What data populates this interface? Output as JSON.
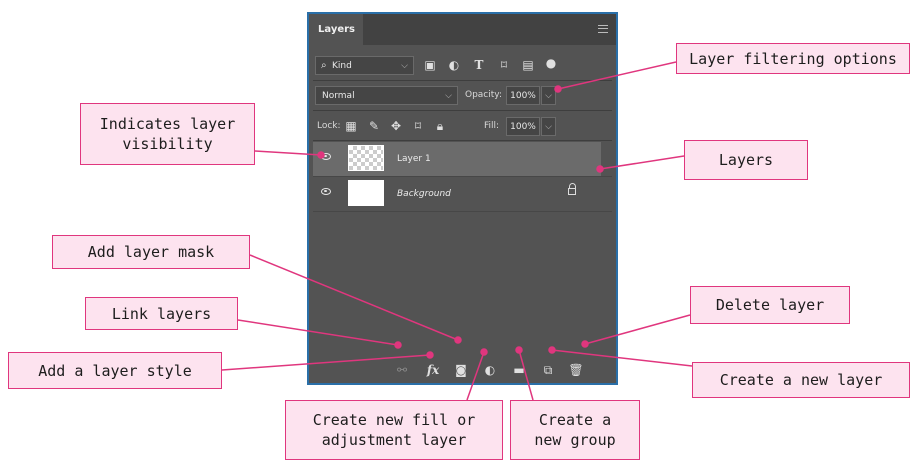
{
  "panel": {
    "tab_label": "Layers",
    "filter": {
      "kind_label": "Kind"
    },
    "blend": {
      "mode": "Normal",
      "opacity_label": "Opacity:",
      "opacity_value": "100%"
    },
    "lock": {
      "lock_label": "Lock:",
      "fill_label": "Fill:",
      "fill_value": "100%"
    },
    "layers": [
      {
        "name": "Layer 1",
        "visible": true,
        "selected": true,
        "thumbnail": "transparent"
      },
      {
        "name": "Background",
        "visible": true,
        "selected": false,
        "thumbnail": "white",
        "locked": true
      }
    ],
    "bottom_icons": [
      "link-icon",
      "fx-icon",
      "mask-icon",
      "adjustment-icon",
      "folder-icon",
      "new-layer-icon",
      "trash-icon"
    ],
    "fx_glyph": "fx"
  },
  "callouts": {
    "filtering": "Layer filtering options",
    "visibility": "Indicates layer visibility",
    "layers": "Layers",
    "mask": "Add layer mask",
    "link": "Link layers",
    "delete": "Delete layer",
    "style": "Add a layer style",
    "new_layer": "Create a new layer",
    "fill_adjust": "Create new fill or adjustment layer",
    "group": "Create a new group"
  },
  "colors": {
    "callout_border": "#e0367e",
    "callout_fill": "#fde3ef",
    "panel_bg": "#535353",
    "panel_border": "#2a6fa8"
  }
}
